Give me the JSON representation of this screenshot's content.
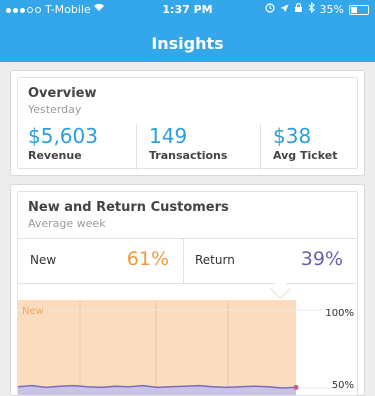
{
  "status_bar": {
    "carrier": "T-Mobile",
    "time": "1:37 PM",
    "battery": "35%",
    "signal_icon": "wifi-icon",
    "status_icons": [
      "alarm-icon",
      "location-icon",
      "lock-rotation-icon",
      "bluetooth-icon"
    ]
  },
  "nav": {
    "title": "Insights"
  },
  "overview": {
    "title": "Overview",
    "subtitle": "Yesterday",
    "metrics": [
      {
        "value": "$5,603",
        "label": "Revenue"
      },
      {
        "value": "149",
        "label": "Transactions"
      },
      {
        "value": "$38",
        "label": "Avg Ticket"
      }
    ]
  },
  "customers": {
    "title": "New and Return Customers",
    "subtitle": "Average week",
    "new_label": "New",
    "new_value": "61%",
    "return_label": "Return",
    "return_value": "39%"
  },
  "chart_data": {
    "type": "area",
    "series": [
      {
        "name": "New",
        "values": [
          0.94,
          0.94,
          0.94,
          0.94,
          0.94,
          0.94,
          0.94,
          0.94,
          0.94,
          0.94,
          0.94,
          0.94,
          0.94,
          0.94,
          0.94,
          0.94,
          0.94,
          0.94,
          0.94,
          0.94,
          0.94
        ]
      },
      {
        "name": "Return",
        "values": [
          0.36,
          0.37,
          0.355,
          0.365,
          0.37,
          0.36,
          0.355,
          0.365,
          0.36,
          0.37,
          0.355,
          0.36,
          0.365,
          0.37,
          0.36,
          0.355,
          0.36,
          0.365,
          0.36,
          0.35,
          0.355
        ]
      }
    ],
    "series_label": "New",
    "tick_labels": [
      "100%",
      "50%"
    ],
    "colors": {
      "new_fill": "#fbdcbf",
      "new_label": "#f0a55c",
      "return_fill": "#c9c3e6",
      "return_line": "#7b6bc0",
      "grid": "#f1c79a"
    }
  }
}
